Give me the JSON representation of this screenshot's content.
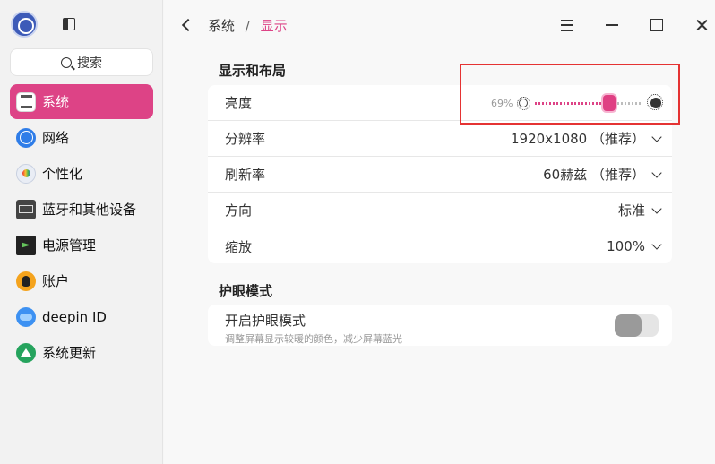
{
  "sidebar": {
    "search_label": "搜索",
    "items": [
      {
        "label": "系统",
        "icon": "system-icon"
      },
      {
        "label": "网络",
        "icon": "network-icon"
      },
      {
        "label": "个性化",
        "icon": "personalization-icon"
      },
      {
        "label": "蓝牙和其他设备",
        "icon": "bluetooth-devices-icon"
      },
      {
        "label": "电源管理",
        "icon": "power-management-icon"
      },
      {
        "label": "账户",
        "icon": "account-icon"
      },
      {
        "label": "deepin ID",
        "icon": "deepin-id-icon"
      },
      {
        "label": "系统更新",
        "icon": "system-update-icon"
      }
    ]
  },
  "header": {
    "breadcrumb_parent": "系统",
    "breadcrumb_separator": "/",
    "breadcrumb_current": "显示"
  },
  "display": {
    "section_title": "显示和布局",
    "brightness": {
      "label": "亮度",
      "value_text": "69%",
      "value": 0.69
    },
    "resolution": {
      "label": "分辨率",
      "value": "1920x1080 （推荐）"
    },
    "refresh_rate": {
      "label": "刷新率",
      "value": "60赫兹 （推荐）"
    },
    "orientation": {
      "label": "方向",
      "value": "标准"
    },
    "scale": {
      "label": "缩放",
      "value": "100%"
    }
  },
  "eye_protection": {
    "section_title": "护眼模式",
    "toggle_label": "开启护眼模式",
    "toggle_description": "调整屏幕显示较暖的颜色，减少屏幕蓝光",
    "enabled": false
  },
  "colors": {
    "accent": "#dd4386",
    "highlight_box": "#e53333"
  }
}
